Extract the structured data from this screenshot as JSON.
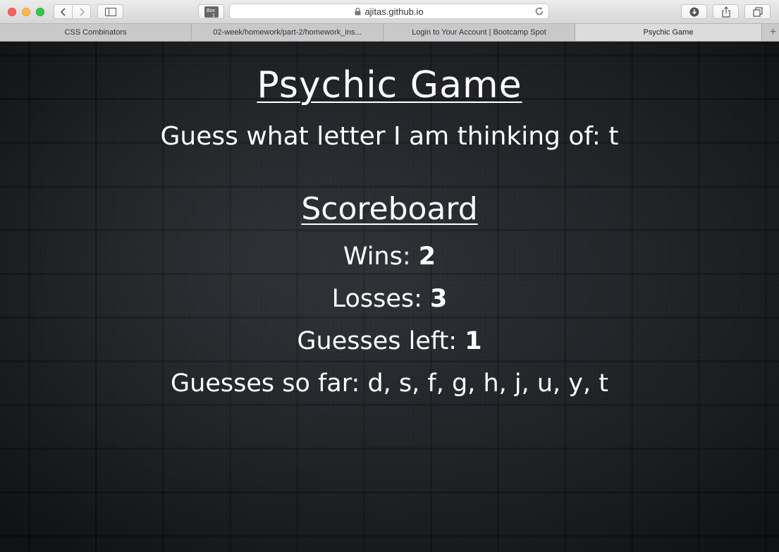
{
  "browser": {
    "url": "ajitas.github.io",
    "tabs": [
      {
        "label": "CSS Combinators",
        "active": false
      },
      {
        "label": "02-week/homework/part-2/homework_ins...",
        "active": false
      },
      {
        "label": "Login to Your Account | Bootcamp Spot",
        "active": false
      },
      {
        "label": "Psychic Game",
        "active": true
      }
    ],
    "new_tab_symbol": "+",
    "icons": {
      "back": "chevron-left-icon",
      "forward": "chevron-right-icon",
      "sidebar": "sidebar-icon",
      "extension": "box-icon",
      "lock": "lock-icon",
      "reload": "reload-icon",
      "download": "download-icon",
      "share": "share-icon",
      "tabs": "tabs-overview-icon"
    }
  },
  "game": {
    "title": "Psychic Game",
    "prompt_label": "Guess what letter I am thinking of: ",
    "prompt_letter": "t",
    "scoreboard_title": "Scoreboard",
    "wins_label": "Wins: ",
    "wins": "2",
    "losses_label": "Losses: ",
    "losses": "3",
    "guesses_left_label": "Guesses left: ",
    "guesses_left": "1",
    "guesses_so_far_label": "Guesses so far: ",
    "guesses_so_far": "d, s, f, g, h, j, u, y, t"
  },
  "colors": {
    "text": "#ffffff",
    "background": "#24272c"
  }
}
